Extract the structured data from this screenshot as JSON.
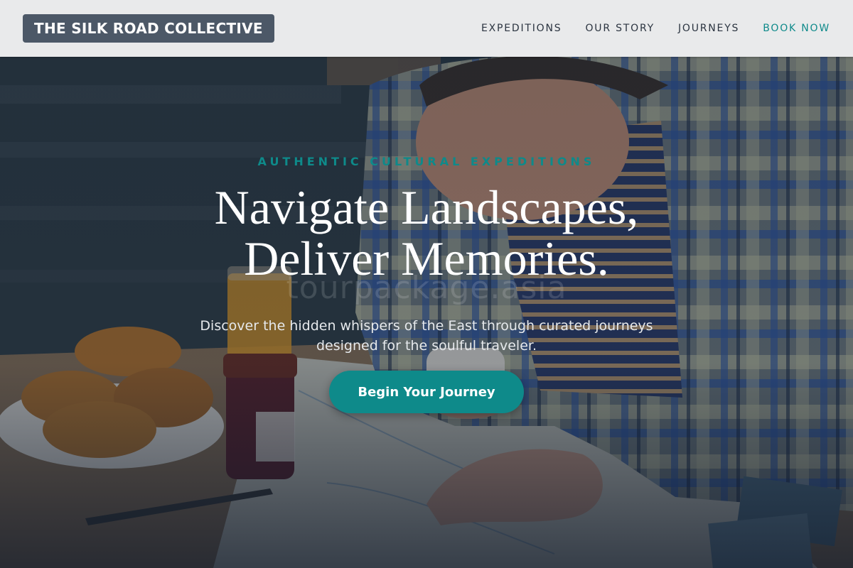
{
  "header": {
    "brand": "THE SILK ROAD COLLECTIVE",
    "nav": [
      {
        "label": "EXPEDITIONS"
      },
      {
        "label": "OUR STORY"
      },
      {
        "label": "JOURNEYS"
      },
      {
        "label": "BOOK NOW"
      }
    ]
  },
  "hero": {
    "eyebrow": "AUTHENTIC CULTURAL EXPEDITIONS",
    "headline_line1": "Navigate Landscapes,",
    "headline_line2": "Deliver Memories.",
    "watermark": "tourpackage.asia",
    "subtitle": "Discover the hidden whispers of the East through curated journeys designed for the soulful traveler.",
    "cta_label": "Begin Your Journey"
  },
  "colors": {
    "accent": "#0e8a8a",
    "brand_badge": "#4c5867",
    "navbar_bg": "#e9eaeb"
  }
}
